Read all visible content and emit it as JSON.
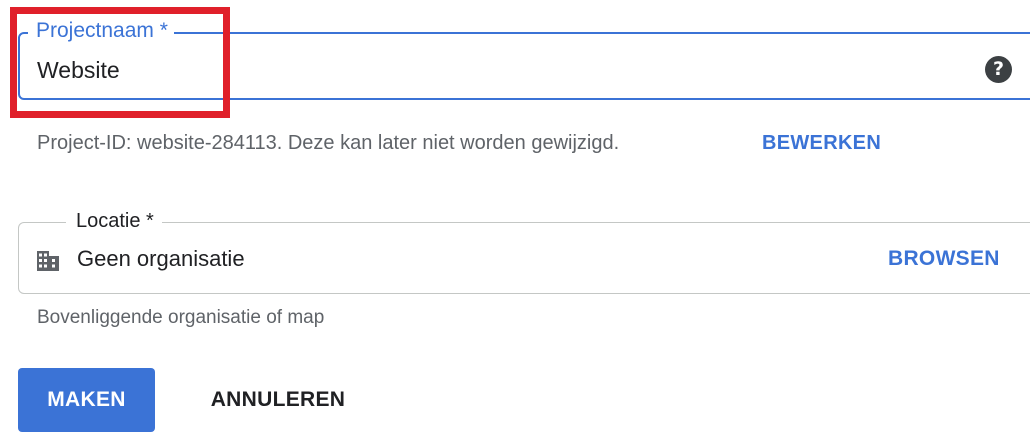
{
  "project_name_field": {
    "label": "Projectnaam *",
    "value": "Website",
    "help_icon": "help-circle-icon"
  },
  "project_id_text": "Project-ID: website-284113. Deze kan later niet worden gewijzigd.",
  "edit_label": "BEWERKEN",
  "location_field": {
    "label": "Locatie *",
    "value": "Geen organisatie",
    "icon": "building-icon",
    "browse_label": "BROWSEN",
    "helper_text": "Bovenliggende organisatie of map"
  },
  "actions": {
    "create_label": "MAKEN",
    "cancel_label": "ANNULEREN"
  },
  "colors": {
    "accent": "#3b73d6",
    "highlight": "#e0202a",
    "text": "#202124",
    "secondary_text": "#5f6368"
  }
}
